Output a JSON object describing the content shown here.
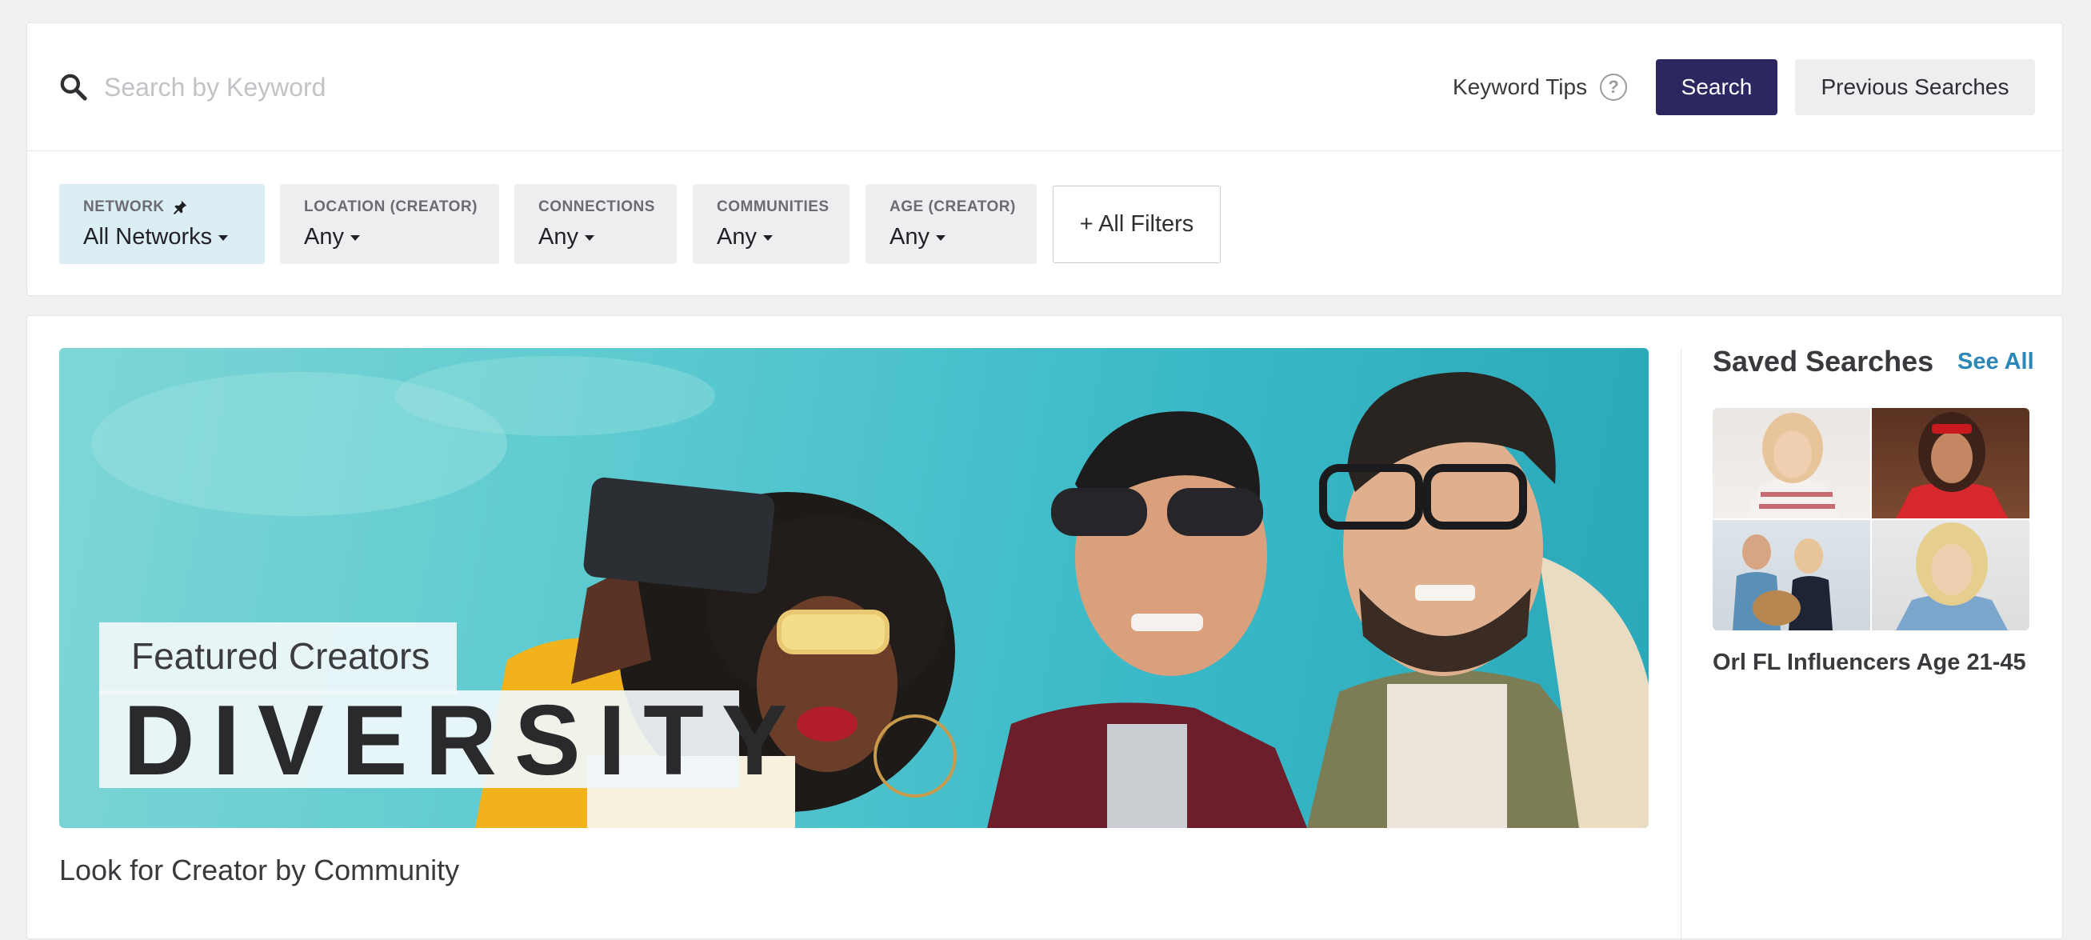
{
  "search": {
    "placeholder": "Search by Keyword",
    "keyword_tips": "Keyword Tips",
    "search_button": "Search",
    "previous_button": "Previous Searches"
  },
  "filters": [
    {
      "label": "NETWORK",
      "value": "All Networks",
      "pinned": true,
      "active": true
    },
    {
      "label": "LOCATION (CREATOR)",
      "value": "Any"
    },
    {
      "label": "CONNECTIONS",
      "value": "Any"
    },
    {
      "label": "COMMUNITIES",
      "value": "Any"
    },
    {
      "label": "AGE (CREATOR)",
      "value": "Any"
    }
  ],
  "all_filters": "+ All Filters",
  "banner": {
    "kicker": "Featured Creators",
    "headline": "DIVERSITY"
  },
  "community_section_title": "Look for Creator by Community",
  "saved_searches": {
    "title": "Saved Searches",
    "see_all": "See All",
    "items": [
      {
        "name": "Orl FL Influencers Age 21-45"
      }
    ]
  },
  "colors": {
    "primary_button": "#2d2761",
    "link": "#2b87b7",
    "active_filter": "#daeef4"
  }
}
